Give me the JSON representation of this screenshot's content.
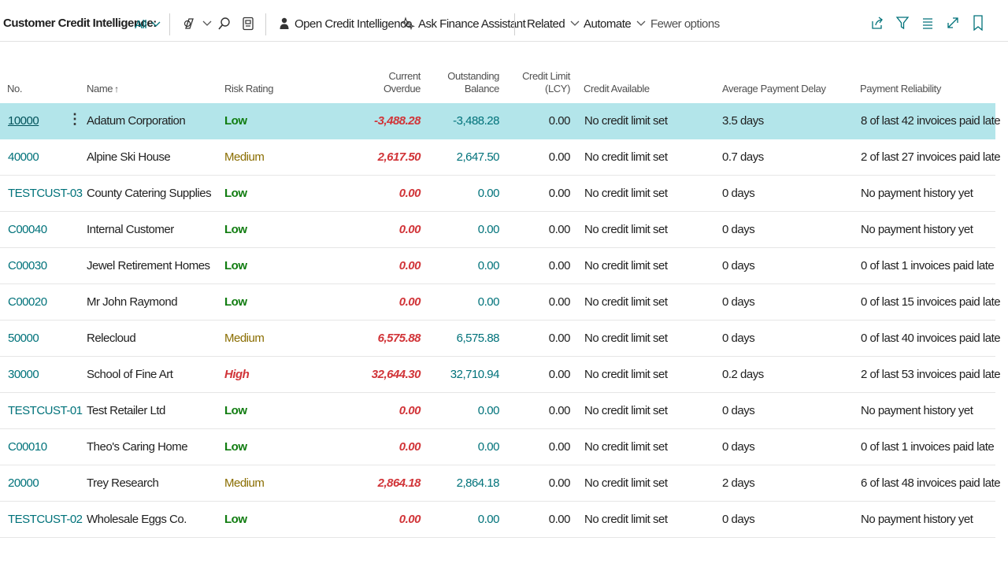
{
  "toolbar": {
    "title": "Customer Credit Intelligence:",
    "view": "All",
    "actions": {
      "open_credit_intelligence": "Open Credit Intelligence",
      "ask_finance_assistant": "Ask Finance Assistant",
      "related": "Related",
      "automate": "Automate",
      "fewer_options": "Fewer options"
    },
    "icons": [
      "copilot-icon",
      "search-icon",
      "excel-icon",
      "person-icon",
      "sparkle-icon",
      "share-icon",
      "filter-icon",
      "list-icon",
      "expand-icon",
      "bookmark-icon"
    ]
  },
  "table": {
    "headers": {
      "no": "No.",
      "name": "Name",
      "name_sort": "↑",
      "risk": "Risk Rating",
      "overdue_1": "Current",
      "overdue_2": "Overdue",
      "balance_1": "Outstanding",
      "balance_2": "Balance",
      "limit_1": "Credit Limit",
      "limit_2": "(LCY)",
      "available": "Credit Available",
      "delay": "Average Payment Delay",
      "reliability": "Payment Reliability"
    },
    "rows": [
      {
        "no": "10000",
        "name": "Adatum Corporation",
        "risk": "Low",
        "overdue": "-3,488.28",
        "balance": "-3,488.28",
        "limit": "0.00",
        "available": "No credit limit set",
        "delay": "3.5 days",
        "reliability": "8 of last 42 invoices paid late"
      },
      {
        "no": "40000",
        "name": "Alpine Ski House",
        "risk": "Medium",
        "overdue": "2,617.50",
        "balance": "2,647.50",
        "limit": "0.00",
        "available": "No credit limit set",
        "delay": "0.7 days",
        "reliability": "2 of last 27 invoices paid late"
      },
      {
        "no": "TESTCUST-03",
        "name": "County Catering Supplies",
        "risk": "Low",
        "overdue": "0.00",
        "balance": "0.00",
        "limit": "0.00",
        "available": "No credit limit set",
        "delay": "0 days",
        "reliability": "No payment history yet"
      },
      {
        "no": "C00040",
        "name": "Internal Customer",
        "risk": "Low",
        "overdue": "0.00",
        "balance": "0.00",
        "limit": "0.00",
        "available": "No credit limit set",
        "delay": "0 days",
        "reliability": "No payment history yet"
      },
      {
        "no": "C00030",
        "name": "Jewel Retirement Homes",
        "risk": "Low",
        "overdue": "0.00",
        "balance": "0.00",
        "limit": "0.00",
        "available": "No credit limit set",
        "delay": "0 days",
        "reliability": "0 of last 1 invoices paid late"
      },
      {
        "no": "C00020",
        "name": "Mr John Raymond",
        "risk": "Low",
        "overdue": "0.00",
        "balance": "0.00",
        "limit": "0.00",
        "available": "No credit limit set",
        "delay": "0 days",
        "reliability": "0 of last 15 invoices paid late"
      },
      {
        "no": "50000",
        "name": "Relecloud",
        "risk": "Medium",
        "overdue": "6,575.88",
        "balance": "6,575.88",
        "limit": "0.00",
        "available": "No credit limit set",
        "delay": "0 days",
        "reliability": "0 of last 40 invoices paid late"
      },
      {
        "no": "30000",
        "name": "School of Fine Art",
        "risk": "High",
        "overdue": "32,644.30",
        "balance": "32,710.94",
        "limit": "0.00",
        "available": "No credit limit set",
        "delay": "0.2 days",
        "reliability": "2 of last 53 invoices paid late"
      },
      {
        "no": "TESTCUST-01",
        "name": "Test Retailer Ltd",
        "risk": "Low",
        "overdue": "0.00",
        "balance": "0.00",
        "limit": "0.00",
        "available": "No credit limit set",
        "delay": "0 days",
        "reliability": "No payment history yet"
      },
      {
        "no": "C00010",
        "name": "Theo's Caring Home",
        "risk": "Low",
        "overdue": "0.00",
        "balance": "0.00",
        "limit": "0.00",
        "available": "No credit limit set",
        "delay": "0 days",
        "reliability": "0 of last 1 invoices paid late"
      },
      {
        "no": "20000",
        "name": "Trey Research",
        "risk": "Medium",
        "overdue": "2,864.18",
        "balance": "2,864.18",
        "limit": "0.00",
        "available": "No credit limit set",
        "delay": "2 days",
        "reliability": "6 of last 48 invoices paid late"
      },
      {
        "no": "TESTCUST-02",
        "name": "Wholesale Eggs Co.",
        "risk": "Low",
        "overdue": "0.00",
        "balance": "0.00",
        "limit": "0.00",
        "available": "No credit limit set",
        "delay": "0 days",
        "reliability": "No payment history yet"
      }
    ]
  },
  "colors": {
    "accent": "#00727a",
    "selected_row": "#b3e5ea",
    "risk_low": "#107c10",
    "risk_medium": "#8a6d00",
    "risk_high": "#d13438",
    "overdue": "#d13438"
  }
}
